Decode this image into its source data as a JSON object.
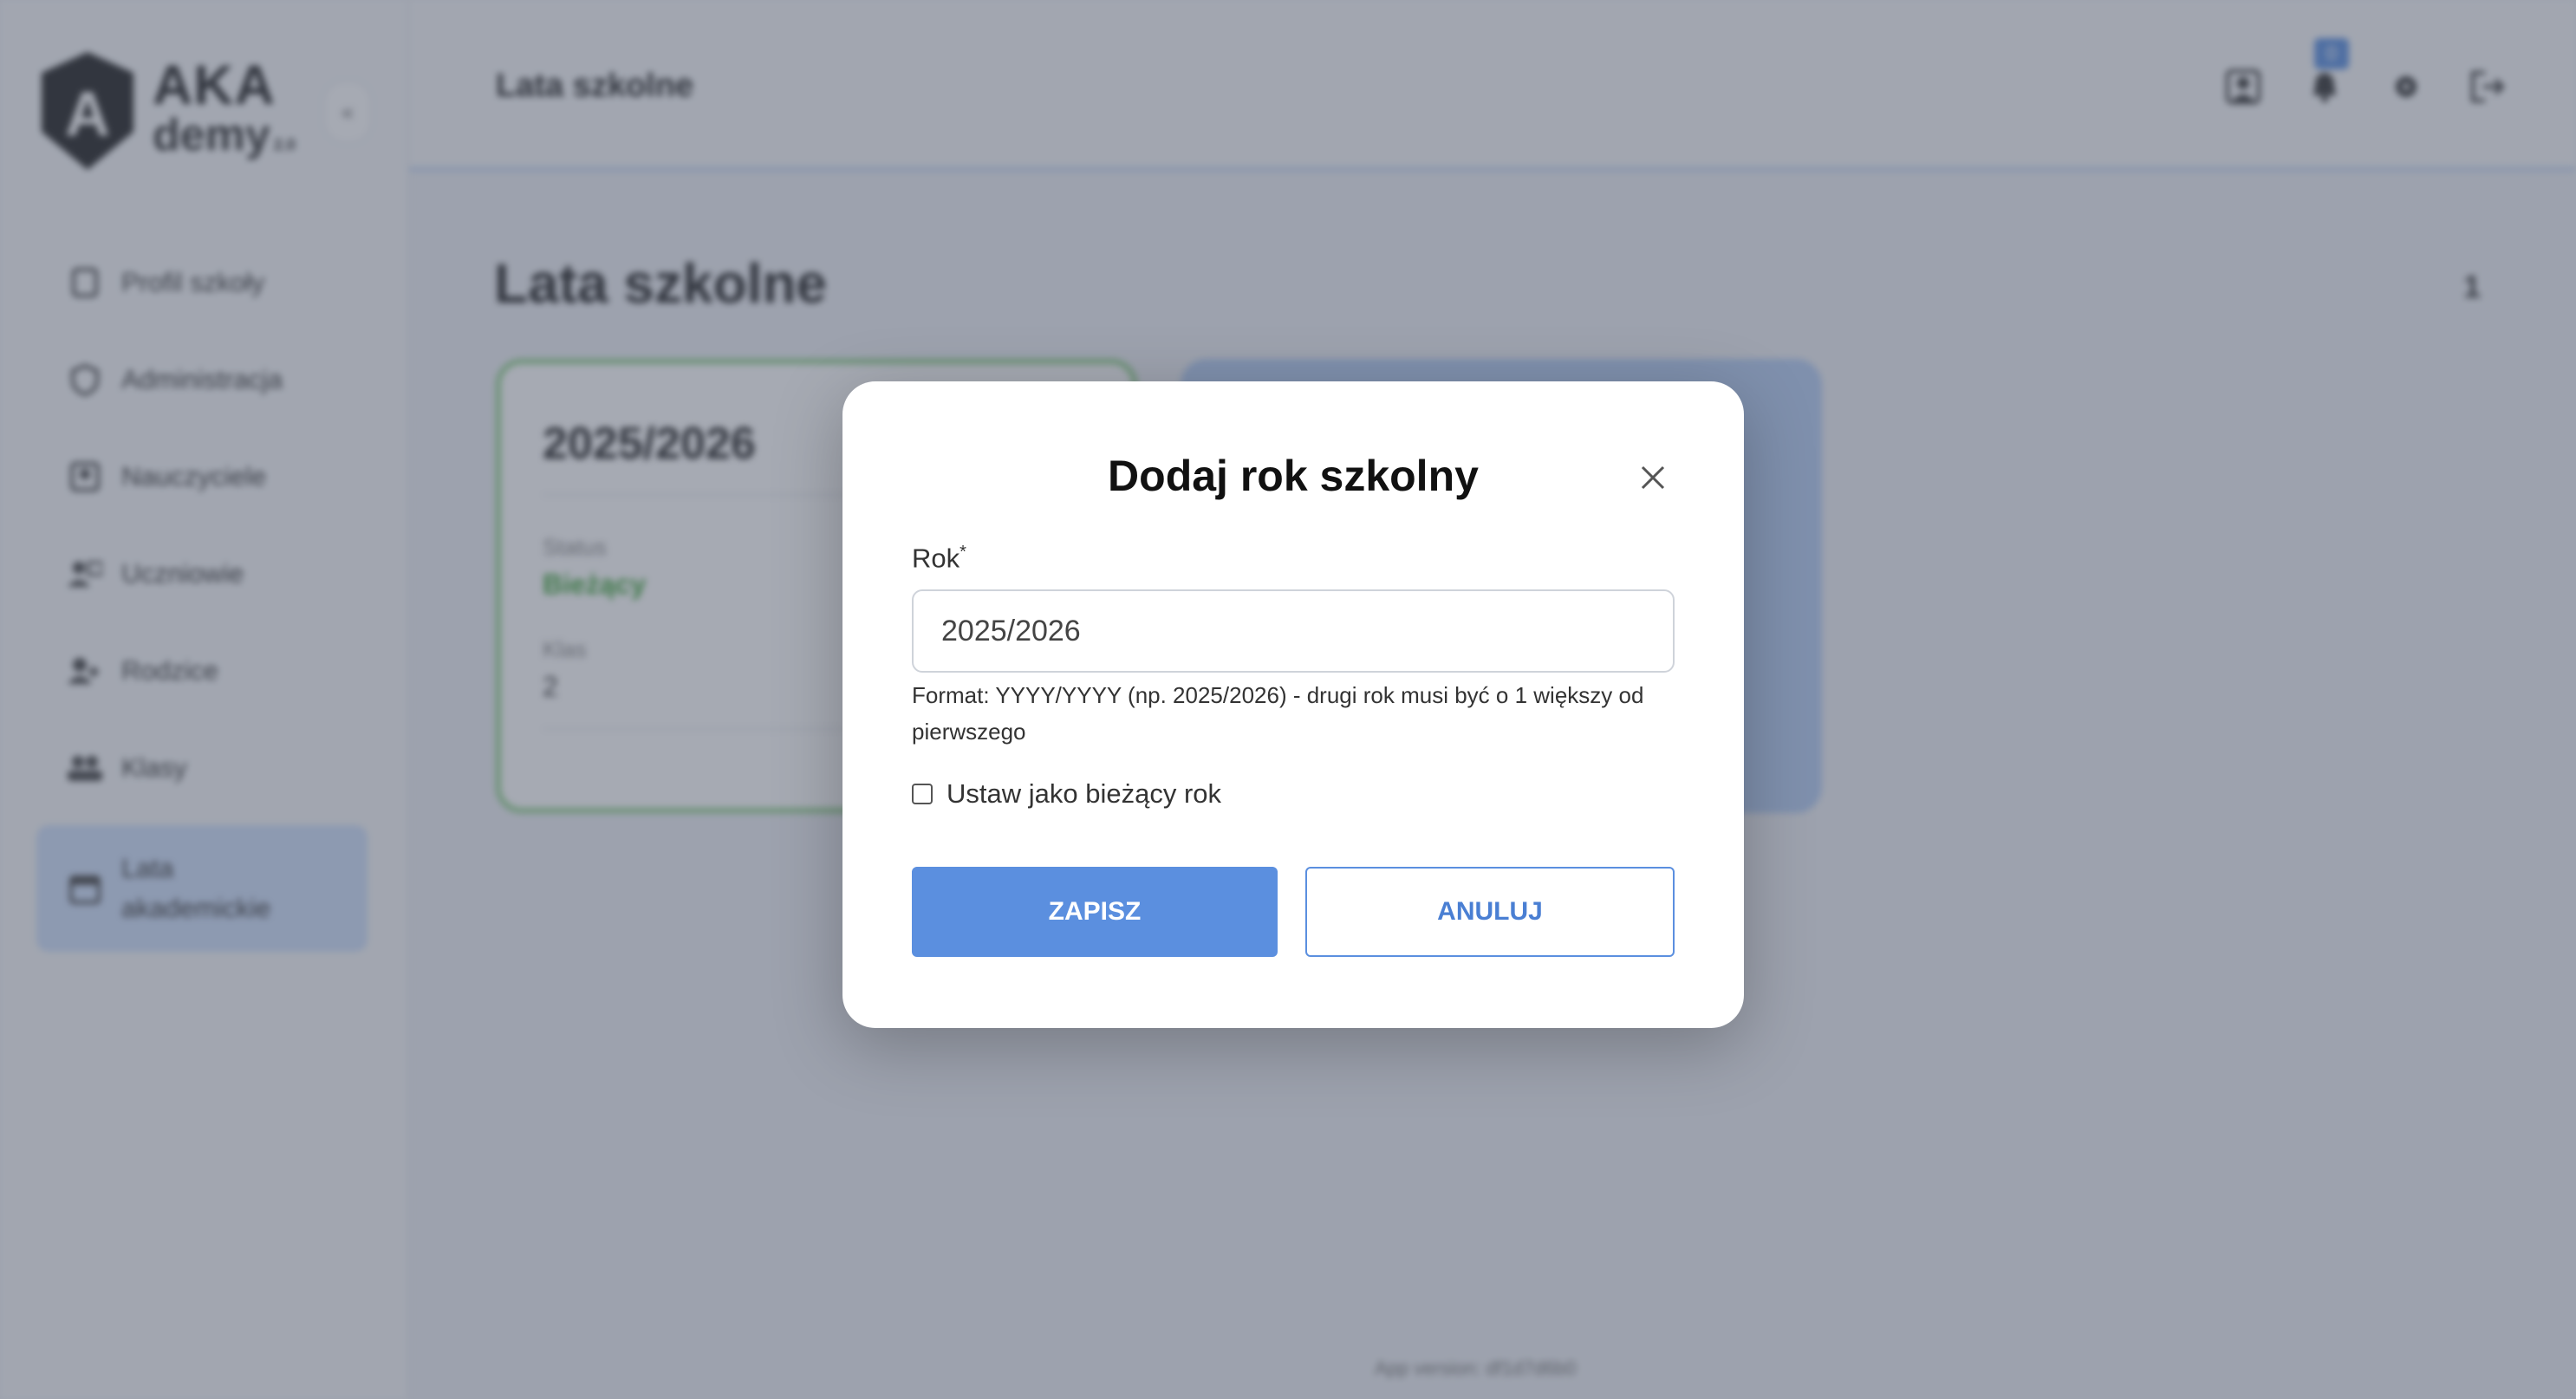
{
  "app": {
    "logo": {
      "line1": "AKA",
      "line2": "demy",
      "version": "2.0"
    },
    "collapse_icon": "chevrons-left-icon"
  },
  "sidebar": {
    "items": [
      {
        "label": "Profil szkoły",
        "icon": "school-icon"
      },
      {
        "label": "Administracja",
        "icon": "shield-icon"
      },
      {
        "label": "Nauczyciele",
        "icon": "teacher-icon"
      },
      {
        "label": "Uczniowie",
        "icon": "students-icon"
      },
      {
        "label": "Rodzice",
        "icon": "parent-icon"
      },
      {
        "label": "Klasy",
        "icon": "classes-icon"
      },
      {
        "label": "Lata akademickie",
        "icon": "calendar-icon",
        "active": true
      }
    ]
  },
  "header": {
    "title": "Lata szkolne",
    "notification_count": "0",
    "icons": [
      "user-card-icon",
      "bell-icon",
      "settings-icon",
      "logout-icon"
    ]
  },
  "main": {
    "title": "Lata szkolne",
    "count": "1",
    "card": {
      "year": "2025/2026",
      "status_label": "Status",
      "status_value": "Bieżący",
      "classes_label": "Klas",
      "classes_value": "2"
    },
    "footer": "App version: df1d7d6b0"
  },
  "modal": {
    "title": "Dodaj rok szkolny",
    "field_label": "Rok",
    "required_mark": "*",
    "field_value": "2025/2026",
    "hint": "Format: YYYY/YYYY (np. 2025/2026) - drugi rok musi być o 1 większy od pierwszego",
    "checkbox_label": "Ustaw jako bieżący rok",
    "checkbox_checked": false,
    "save_label": "ZAPISZ",
    "cancel_label": "ANULUJ"
  },
  "colors": {
    "accent": "#5b8fdf",
    "status_current": "#3fa33a",
    "card_border": "#8fd18a",
    "active_nav": "#cfe0fb"
  }
}
